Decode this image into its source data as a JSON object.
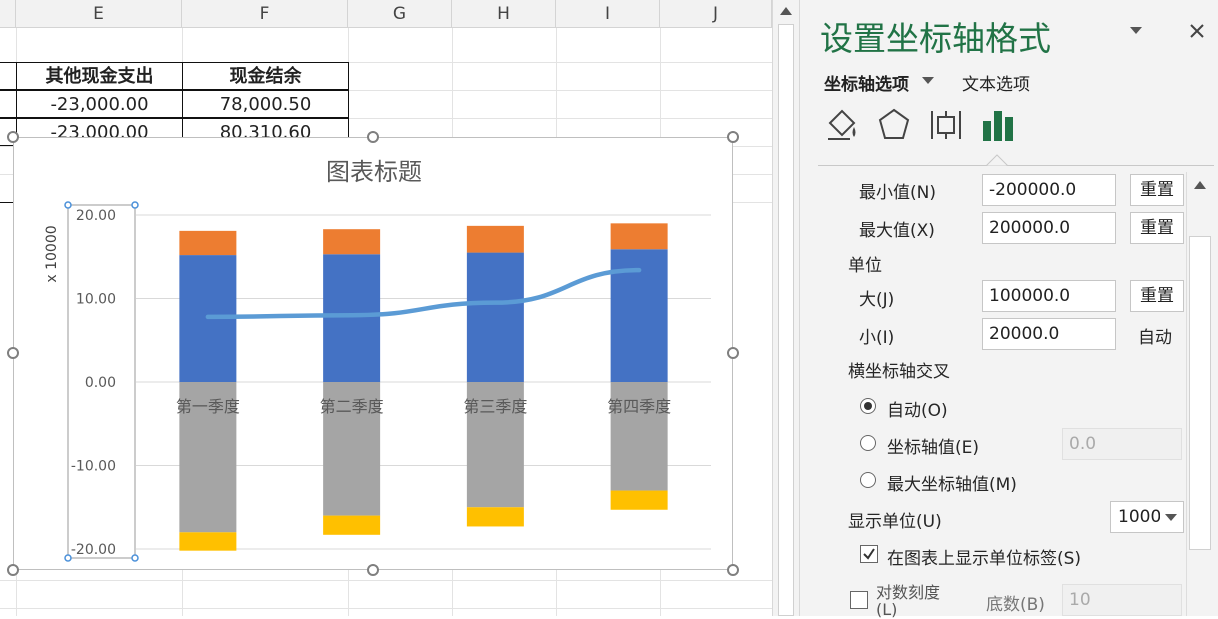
{
  "sheet": {
    "columns": [
      "E",
      "F",
      "G",
      "H",
      "I",
      "J"
    ],
    "table_headers": [
      "其他现金支出",
      "现金结余"
    ],
    "rows": [
      [
        "-23,000.00",
        "78,000.50"
      ],
      [
        "-23,000.00",
        "80,310.60"
      ]
    ]
  },
  "chart_data": {
    "type": "bar",
    "stacked": true,
    "title": "图表标题",
    "ylabel": "x 10000",
    "ylim": [
      -20,
      20
    ],
    "yticks": [
      "20.00",
      "10.00",
      "0.00",
      "-10.00",
      "-20.00"
    ],
    "categories": [
      "第一季度",
      "第二季度",
      "第三季度",
      "第四季度"
    ],
    "series": [
      {
        "color": "#4472c4",
        "values": [
          15.2,
          15.3,
          15.5,
          15.9
        ],
        "kind": "bar"
      },
      {
        "color": "#ed7d31",
        "values": [
          2.9,
          3.0,
          3.2,
          3.1
        ],
        "kind": "bar"
      },
      {
        "color": "#a5a5a5",
        "values": [
          -18.0,
          -16.0,
          -15.0,
          -13.0
        ],
        "kind": "bar"
      },
      {
        "color": "#ffc000",
        "values": [
          -2.2,
          -2.3,
          -2.3,
          -2.3
        ],
        "kind": "bar"
      },
      {
        "color": "#5b9bd5",
        "values": [
          7.8,
          8.0,
          9.5,
          13.4
        ],
        "kind": "line"
      }
    ]
  },
  "pane": {
    "title": "设置坐标轴格式",
    "tab_axis_options": "坐标轴选项",
    "tab_text_options": "文本选项",
    "min_label": "最小值(N)",
    "min_value": "-200000.0",
    "max_label": "最大值(X)",
    "max_value": "200000.0",
    "reset": "重置",
    "units_label": "单位",
    "major_label": "大(J)",
    "major_value": "100000.0",
    "minor_label": "小(I)",
    "minor_value": "20000.0",
    "auto": "自动",
    "cross_label": "横坐标轴交叉",
    "radio_auto": "自动(O)",
    "radio_axis_value": "坐标轴值(E)",
    "axis_value": "0.0",
    "radio_max": "最大坐标轴值(M)",
    "display_units_label": "显示单位(U)",
    "display_units_value": "1000",
    "show_units_label": "在图表上显示单位标签(S)",
    "log_scale_label": "对数刻度(L)",
    "base_label": "底数(B)",
    "base_value": "10"
  }
}
